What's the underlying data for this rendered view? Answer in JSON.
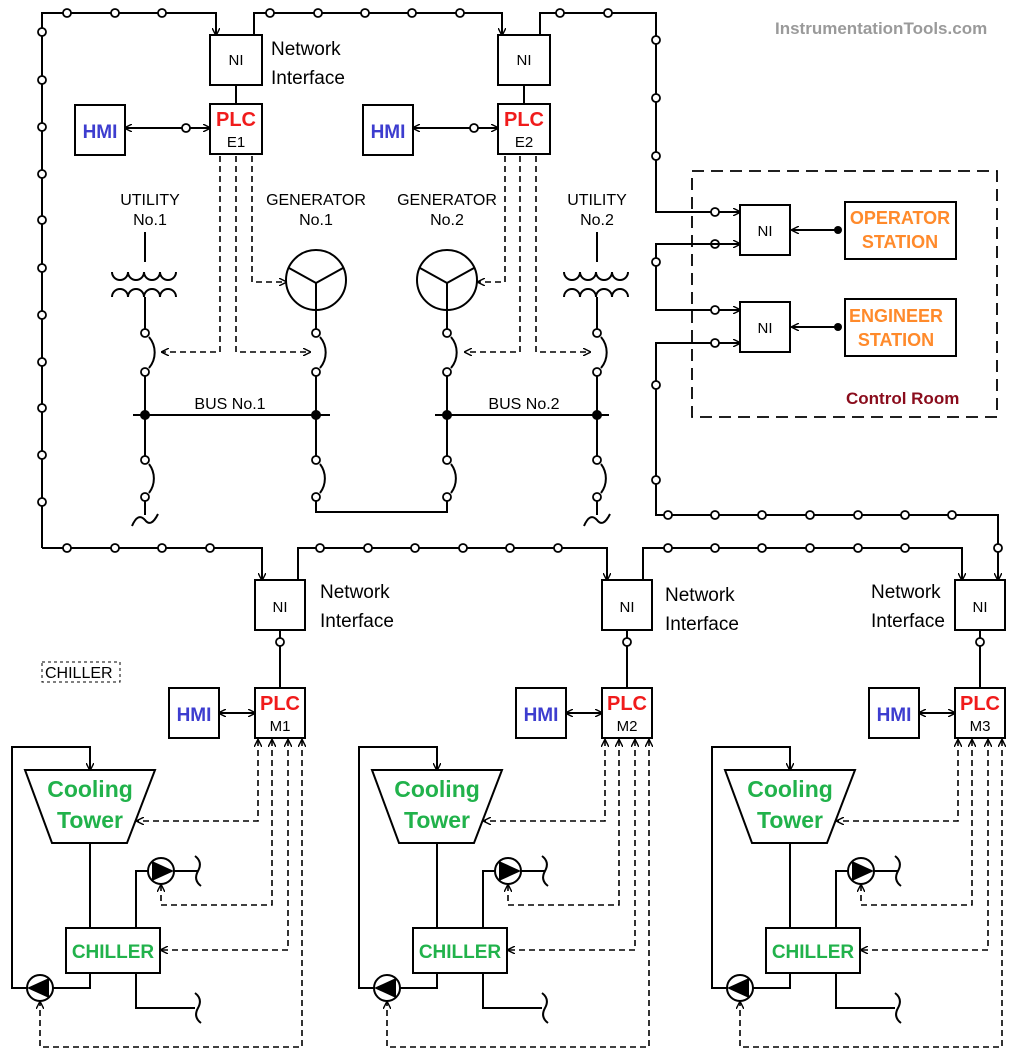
{
  "watermark": "InstrumentationTools.com",
  "ni_label": "NI",
  "network_interface": [
    "Network",
    "Interface"
  ],
  "plc_label": "PLC",
  "hmi_label": "HMI",
  "top_plcs": [
    {
      "id": "E1"
    },
    {
      "id": "E2"
    }
  ],
  "power": {
    "utility1": [
      "UTILITY",
      "No.1"
    ],
    "generator1": [
      "GENERATOR",
      "No.1"
    ],
    "generator2": [
      "GENERATOR",
      "No.2"
    ],
    "utility2": [
      "UTILITY",
      "No.2"
    ],
    "bus1": "BUS  No.1",
    "bus2": "BUS  No.2"
  },
  "control_room": {
    "label": "Control Room",
    "operator_station": [
      "OPERATOR",
      "STATION"
    ],
    "engineer_station": [
      "ENGINEER",
      "STATION"
    ]
  },
  "modules": [
    {
      "id": "M1",
      "cooling_tower": [
        "Cooling",
        "Tower"
      ],
      "chiller": "CHILLER"
    },
    {
      "id": "M2",
      "cooling_tower": [
        "Cooling",
        "Tower"
      ],
      "chiller": "CHILLER"
    },
    {
      "id": "M3",
      "cooling_tower": [
        "Cooling",
        "Tower"
      ],
      "chiller": "CHILLER"
    }
  ],
  "stray_label": "CHILLER",
  "colors": {
    "plc": "#f01b1b",
    "hmi": "#3d3dcf",
    "equipment": "#21b24b",
    "station": "#ff8a2b",
    "control_room": "#8a0c1c",
    "watermark": "#9a9a9a"
  }
}
